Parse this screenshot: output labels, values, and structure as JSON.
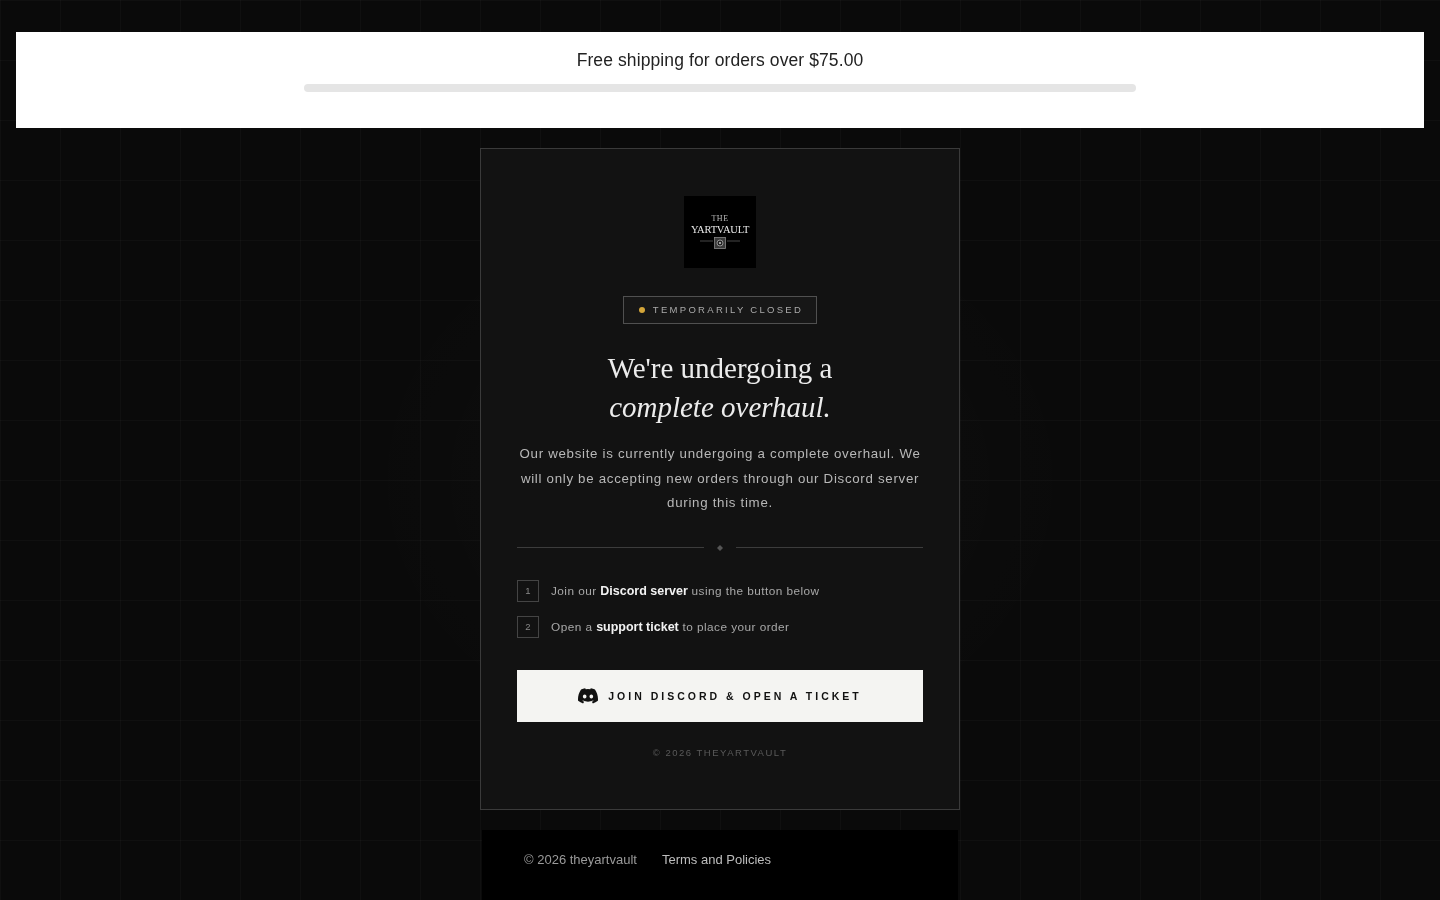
{
  "shipping_banner": {
    "message": "Free shipping for orders over $75.00",
    "level": 0
  },
  "logo": {
    "small_text": "THE",
    "name": "YARTVAULT"
  },
  "status_badge": {
    "label": "TEMPORARILY CLOSED"
  },
  "heading": "We're undergoing a *complete overhaul.*",
  "description": "Our website is currently undergoing a complete overhaul. We will only be accepting new orders through our Discord server during this time.",
  "steps": [
    {
      "number": "1",
      "text": "Join our **Discord server** using the button below"
    },
    {
      "number": "2",
      "text": "Open a **support ticket** to place your order"
    }
  ],
  "cta_button": {
    "label": "JOIN DISCORD & OPEN A TICKET"
  },
  "card_copyright": "© 2026 THEYARTVAULT",
  "footer": {
    "copyright": "© 2026 theyartvault",
    "links": [
      "Terms and Policies"
    ]
  }
}
